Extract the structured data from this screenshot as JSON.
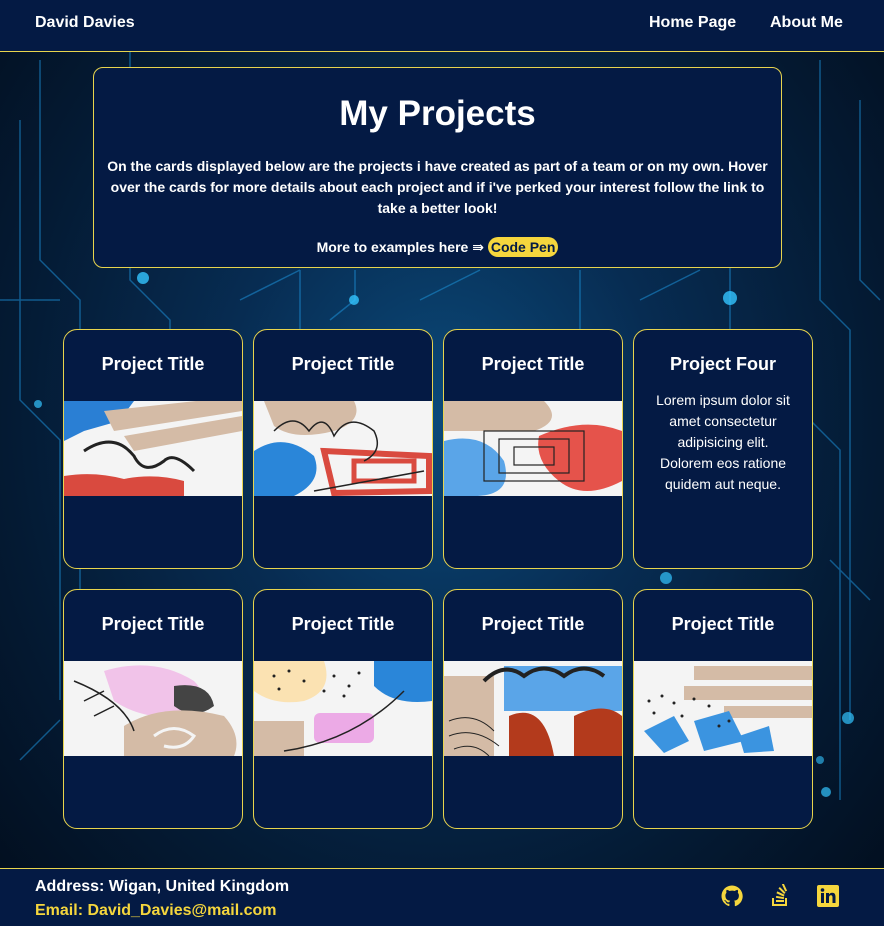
{
  "header": {
    "brand": "David Davies",
    "nav": [
      {
        "label": "Home Page"
      },
      {
        "label": "About Me"
      }
    ]
  },
  "intro": {
    "title": "My Projects",
    "description": "On the cards displayed below are the projects i have created as part of a team or on my own. Hover over the cards for more details about each project and if i've perked your interest follow the link to take a better look!",
    "more_text": "More to examples here ⇛",
    "code_pen_label": "Code Pen"
  },
  "cards": [
    {
      "title": "Project Title",
      "image": "abstract-art-1"
    },
    {
      "title": "Project Title",
      "image": "abstract-art-2"
    },
    {
      "title": "Project Title",
      "image": "abstract-art-3"
    },
    {
      "title": "Project Four",
      "text": "Lorem ipsum dolor sit amet consectetur adipisicing elit. Dolorem eos ratione quidem aut neque."
    },
    {
      "title": "Project Title",
      "image": "abstract-art-5"
    },
    {
      "title": "Project Title",
      "image": "abstract-art-6"
    },
    {
      "title": "Project Title",
      "image": "abstract-art-7"
    },
    {
      "title": "Project Title",
      "image": "abstract-art-8"
    }
  ],
  "footer": {
    "address": "Address: Wigan, United Kingdom",
    "email": "Email: David_Davies@mail.com",
    "social": [
      "github-icon",
      "stackoverflow-icon",
      "linkedin-icon"
    ]
  },
  "colors": {
    "navy": "#041a44",
    "accent": "#f5d63d",
    "border": "#e8d44d"
  }
}
